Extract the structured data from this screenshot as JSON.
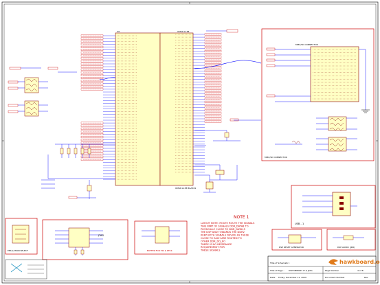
{
  "colors": {
    "wire": "#1a1aff",
    "net_label": "#cc0000",
    "component": "#8a0000",
    "component_fill": "#ffffc4",
    "block_border": "#cc0000",
    "title_block": "#000000",
    "logo_orange": "#e07a1a"
  },
  "ic_main": {
    "ref": "U6",
    "part": "OMAP-L138",
    "footer": "OMAP-L138 BGA361"
  },
  "connector_block": {
    "label": "MMC/SD CONNECTOR",
    "bottom_label": "MMC/SD CONNECTOR"
  },
  "usb_block": {
    "label": "USB - 1"
  },
  "emulation_block": {
    "label": "EMULATION SELECT"
  },
  "jtag_block": {
    "label": "JTAG"
  },
  "buffer_block": {
    "label": "BUFFER FOR TDI & RTCK"
  },
  "reset_block": {
    "label": "DSP RESET GENERATOR"
  },
  "audio_block": {
    "label": "DSP AUDIO (JDR)"
  },
  "note": {
    "title": "NOTE 1",
    "lines": [
      "LAYOUT NOTE: ROUTE        ROUTE THE SIGNALS",
      "THIS PART OF SIGNALS      DDR_DATA8 TO",
      "PHYSICALLY CLOSE TO       DDR_DATA15",
      "THE DSP AND               TOWARDS THE DDR2",
      "KEEP BOTH SIGNALS         DEVICE AS THESE",
      "CLOSE TO EACH             ARE ROUTED TO",
      "OTHER                     DDR_DQ_EO",
      "THERE IS NO IMPEDANCE",
      "REQUIREMENT FOR",
      "THESE SIGNALS"
    ]
  },
  "title_block": {
    "title_of_schematic_label": "Title of Schematic :",
    "title_of_page_label": "Title of Page :",
    "title_of_page": "DSP MEMORY IF & JTAG",
    "page_number_label": "Page Number",
    "page_number": "4 of 8",
    "document_number_label": "Document Number",
    "revision_label": "Rev",
    "date_label": "Date :",
    "date": "Friday, December 11, 2009",
    "brand": "hawkboard.org"
  }
}
